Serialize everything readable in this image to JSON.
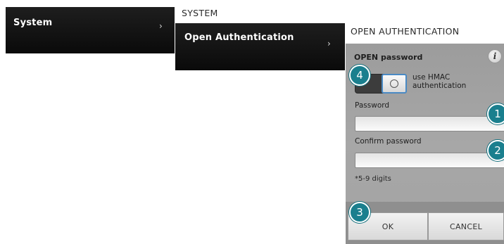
{
  "menu": {
    "level1": {
      "label": "System",
      "chevron": "›"
    },
    "level2": {
      "column_title": "SYSTEM",
      "label": "Open Authentication",
      "chevron": "›"
    }
  },
  "settings": {
    "column_title": "OPEN AUTHENTICATION",
    "section_title": "OPEN password",
    "info_glyph": "i",
    "toggle": {
      "back_glyph": "«",
      "label": "use HMAC authentication",
      "state": "off"
    },
    "password": {
      "label": "Password",
      "value": "",
      "placeholder": ""
    },
    "confirm_password": {
      "label": "Confirm password",
      "value": "",
      "placeholder": ""
    },
    "note": "*5-9 digits",
    "buttons": {
      "ok": "OK",
      "cancel": "CANCEL"
    }
  },
  "callouts": [
    "1",
    "2",
    "3",
    "4"
  ],
  "colors": {
    "callout": "#1a7f8e",
    "toggle_knob_border": "#4a8ac4",
    "menu_bg": "#111111"
  },
  "icons": {
    "info": "info-icon",
    "chevron": "chevron-right-icon",
    "toggle_back": "double-chevron-left-icon"
  }
}
